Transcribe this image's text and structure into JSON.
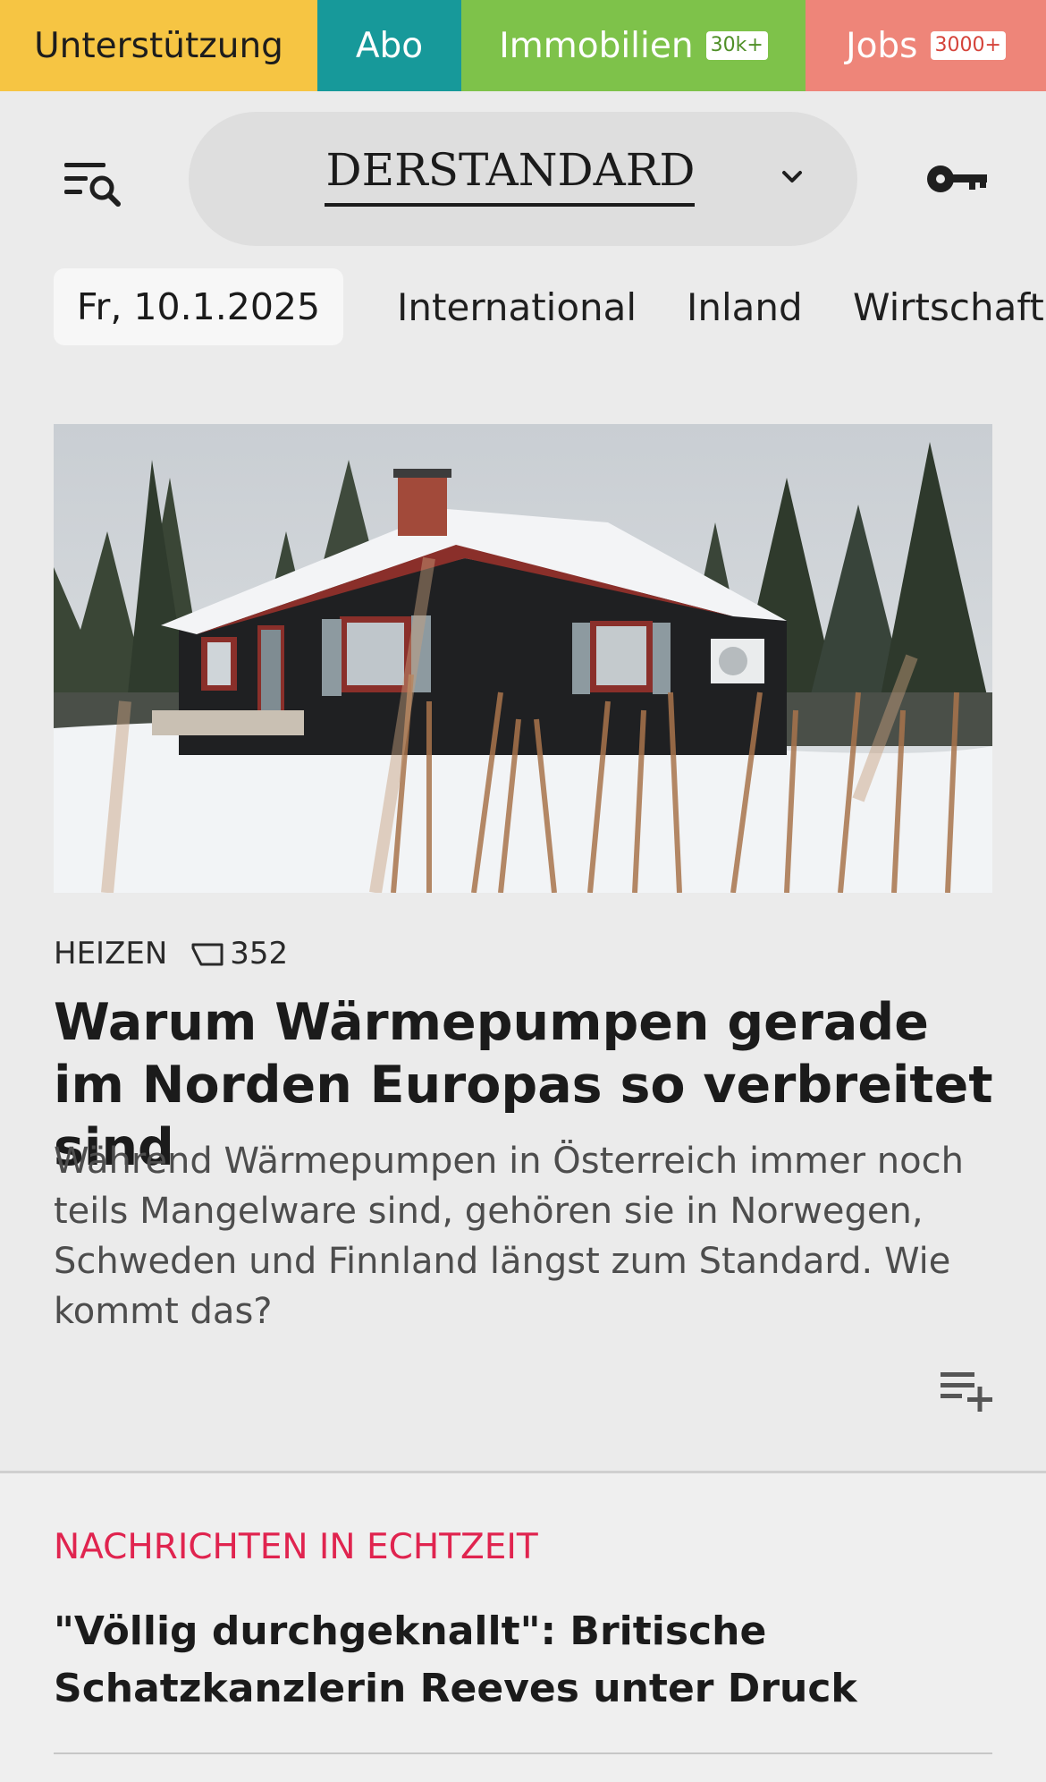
{
  "topbar": {
    "support": "Unterstützung",
    "abo": "Abo",
    "immobilien": "Immobilien",
    "immobilien_badge": "30k+",
    "jobs": "Jobs",
    "jobs_badge": "3000+"
  },
  "header": {
    "brand": "DerStandard",
    "menu_icon": "menu-search-icon",
    "account_icon": "key-icon",
    "dropdown_icon": "chevron-down-icon"
  },
  "nav": {
    "date": "Fr, 10.1.2025",
    "items": [
      "International",
      "Inland",
      "Wirtschaft"
    ]
  },
  "article": {
    "kicker": "HEIZEN",
    "comments": "352",
    "headline": "Warum Wärmepumpen gerade im Norden Europas so verbreitet sind",
    "teaser": "Während Wärmepumpen in Österreich immer noch teils Mangelware sind, gehören sie in Norwegen, Schweden und Finnland längst zum Standard. Wie kommt das?"
  },
  "live": {
    "title": "Nachrichten in Echtzeit",
    "headline": "\"Völlig durchgeknallt\": Britische Schatzkanzlerin Reeves unter Druck"
  },
  "colors": {
    "support": "#f6c543",
    "abo": "#17999a",
    "immobilien": "#7ec24a",
    "jobs": "#ee8579",
    "live_accent": "#e0244f"
  }
}
